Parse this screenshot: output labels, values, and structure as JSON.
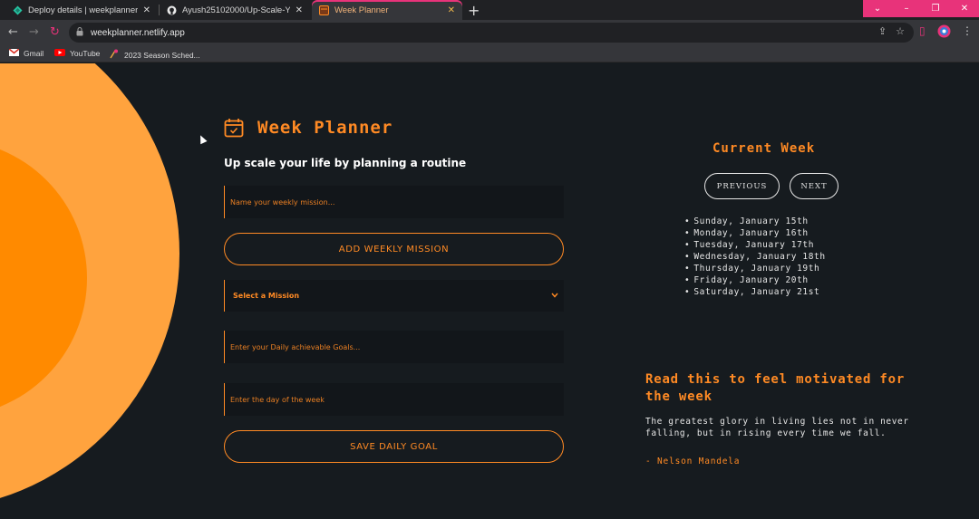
{
  "browser": {
    "tabs": [
      {
        "title": "Deploy details | weekplanner",
        "icon": "netlify-icon"
      },
      {
        "title": "Ayush25102000/Up-Scale-Your-l",
        "icon": "github-icon"
      },
      {
        "title": "Week Planner",
        "icon": "calendar-favicon"
      }
    ],
    "new_tab_label": "+",
    "url": "weekplanner.netlify.app",
    "bookmarks": [
      {
        "label": "Gmail",
        "icon": "gmail-icon"
      },
      {
        "label": "YouTube",
        "icon": "youtube-icon"
      },
      {
        "label": "2023 Season Sched...",
        "icon": "bookmark-page-icon"
      }
    ],
    "accent_color": "#e8337a"
  },
  "app": {
    "title": "Week Planner",
    "tagline": "Up scale your life by planning a routine",
    "mission_input": {
      "placeholder": "Name your weekly mission...",
      "value": ""
    },
    "add_mission_label": "ADD WEEKLY MISSION",
    "mission_select": {
      "selected": "Select a Mission"
    },
    "goal_input": {
      "placeholder": "Enter your Daily achievable Goals...",
      "value": ""
    },
    "day_input": {
      "placeholder": "Enter the day of the week",
      "value": ""
    },
    "save_goal_label": "SAVE DAILY GOAL",
    "accent_color": "#ff8a24"
  },
  "week": {
    "title": "Current Week",
    "previous_label": "PREVIOUS",
    "next_label": "NEXT",
    "days": [
      "Sunday, January 15th",
      "Monday, January 16th",
      "Tuesday, January 17th",
      "Wednesday, January 18th",
      "Thursday, January 19th",
      "Friday, January 20th",
      "Saturday, January 21st"
    ]
  },
  "motivation": {
    "title": "Read this to feel motivated for the week",
    "quote": "The greatest glory in living lies not in never falling, but in rising every time we fall.",
    "author": "- Nelson Mandela"
  }
}
